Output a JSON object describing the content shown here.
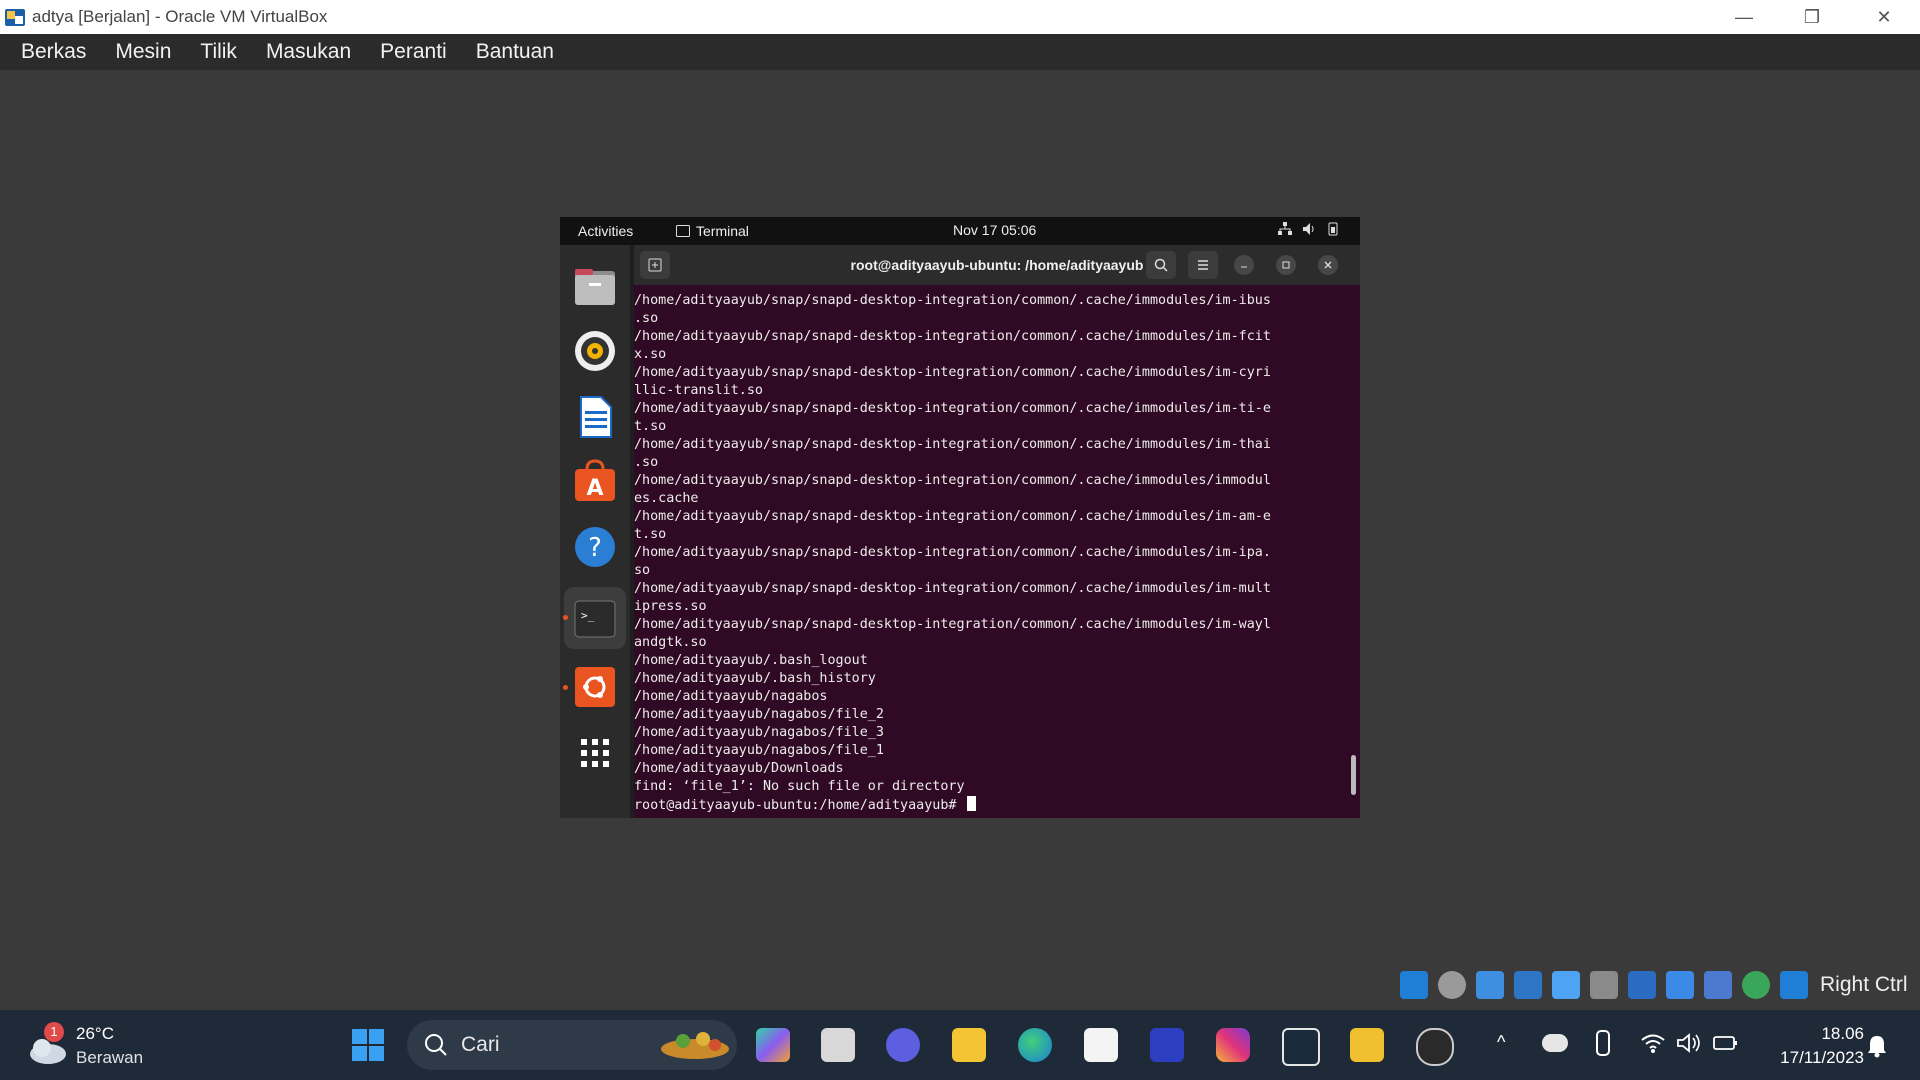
{
  "window": {
    "title": "adtya [Berjalan] - Oracle VM VirtualBox",
    "controls": {
      "minimize": "—",
      "restore": "❐",
      "close": "✕"
    }
  },
  "menu": [
    "Berkas",
    "Mesin",
    "Tilik",
    "Masukan",
    "Peranti",
    "Bantuan"
  ],
  "ubuntu": {
    "topbar": {
      "activities": "Activities",
      "app": "Terminal",
      "clock": "Nov 17  05:06"
    },
    "dock": [
      "files-icon",
      "rhythmbox-icon",
      "writer-icon",
      "software-icon",
      "help-icon",
      "terminal-icon",
      "ubuntu-icon",
      "app-grid-icon"
    ],
    "terminal": {
      "title": "root@adityaayub-ubuntu: /home/adityaayub",
      "lines": [
        "/home/adityaayub/snap/snapd-desktop-integration/common/.cache/immodules/im-ibus",
        ".so",
        "/home/adityaayub/snap/snapd-desktop-integration/common/.cache/immodules/im-fcit",
        "x.so",
        "/home/adityaayub/snap/snapd-desktop-integration/common/.cache/immodules/im-cyri",
        "llic-translit.so",
        "/home/adityaayub/snap/snapd-desktop-integration/common/.cache/immodules/im-ti-e",
        "t.so",
        "/home/adityaayub/snap/snapd-desktop-integration/common/.cache/immodules/im-thai",
        ".so",
        "/home/adityaayub/snap/snapd-desktop-integration/common/.cache/immodules/immodul",
        "es.cache",
        "/home/adityaayub/snap/snapd-desktop-integration/common/.cache/immodules/im-am-e",
        "t.so",
        "/home/adityaayub/snap/snapd-desktop-integration/common/.cache/immodules/im-ipa.",
        "so",
        "/home/adityaayub/snap/snapd-desktop-integration/common/.cache/immodules/im-mult",
        "ipress.so",
        "/home/adityaayub/snap/snapd-desktop-integration/common/.cache/immodules/im-wayl",
        "andgtk.so",
        "/home/adityaayub/.bash_logout",
        "/home/adityaayub/.bash_history",
        "/home/adityaayub/nagabos",
        "/home/adityaayub/nagabos/file_2",
        "/home/adityaayub/nagabos/file_3",
        "/home/adityaayub/nagabos/file_1",
        "/home/adityaayub/Downloads",
        "find: ‘file_1’: No such file or directory"
      ],
      "prompt": "root@adityaayub-ubuntu:/home/adityaayub# "
    }
  },
  "vbox_status": {
    "host_key": "Right Ctrl"
  },
  "taskbar": {
    "weather": {
      "temp": "26°C",
      "desc": "Berawan",
      "badge": "1"
    },
    "search_placeholder": "Cari",
    "clock_time": "18.06",
    "clock_date": "17/11/2023"
  }
}
